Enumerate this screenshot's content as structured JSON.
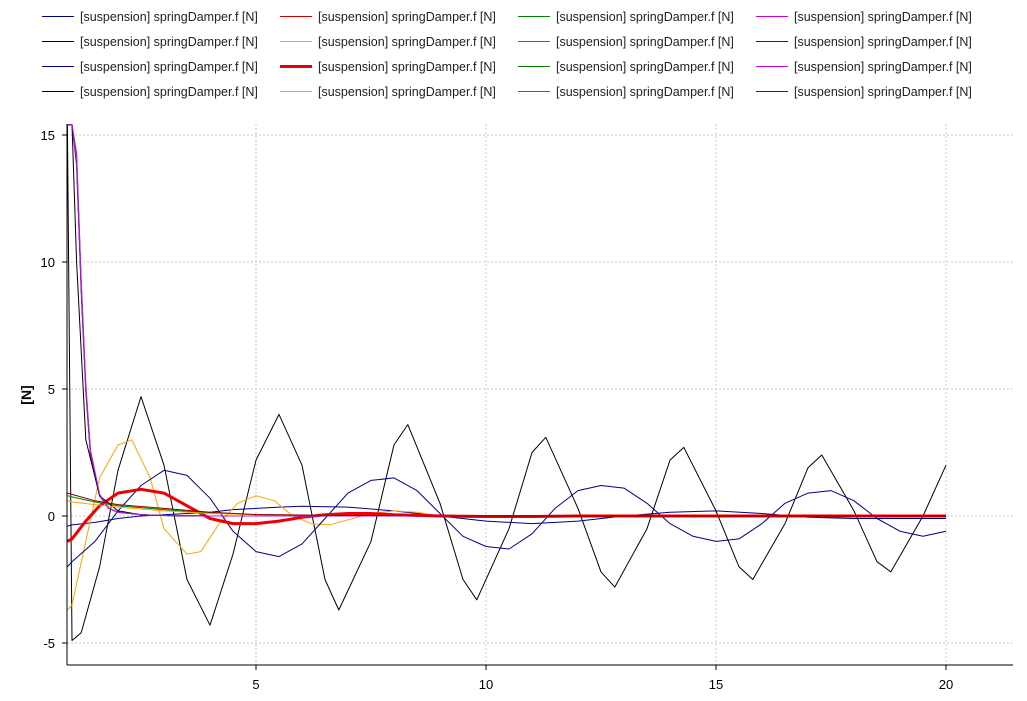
{
  "chart_data": {
    "type": "line",
    "xlabel": "",
    "ylabel": "[N]",
    "xlim": [
      0.5,
      21.5
    ],
    "ylim": [
      -5.8,
      15.4
    ],
    "xticks": [
      5,
      10,
      15,
      20
    ],
    "yticks": [
      -5,
      0,
      5,
      10,
      15
    ],
    "grid": true,
    "legend_position": "top",
    "legend_columns": 4,
    "series": [
      {
        "label": "[suspension] springDamper.f [N]",
        "color": "#00008b",
        "width": 1,
        "x": [
          0.9,
          1.0,
          1.5,
          2.0,
          2.5,
          3.0,
          3.5,
          4.0,
          4.5,
          5.0,
          5.5,
          6.0,
          7.0,
          8.0,
          9.0,
          10.0,
          11.0,
          12.0,
          13.0,
          14.0,
          15.0,
          16.0,
          17.0,
          18.0,
          19.0,
          20.0
        ],
        "y": [
          -0.4,
          -0.35,
          -0.25,
          -0.1,
          0.0,
          0.05,
          0.1,
          0.15,
          0.25,
          0.3,
          0.35,
          0.38,
          0.35,
          0.2,
          0.0,
          -0.2,
          -0.3,
          -0.2,
          0.0,
          0.15,
          0.2,
          0.1,
          -0.05,
          -0.1,
          -0.1,
          -0.1
        ]
      },
      {
        "label": "[suspension] springDamper.f [N]",
        "color": "#cd0000",
        "width": 1,
        "x": [
          0.9,
          1.0,
          1.1,
          1.2,
          1.3,
          1.4,
          1.6,
          1.8,
          2.0,
          2.5,
          3.0,
          4.0,
          5.0,
          10.0,
          20.0
        ],
        "y": [
          15.4,
          15.4,
          14.0,
          9.0,
          5.0,
          2.5,
          0.8,
          0.3,
          0.15,
          0.05,
          0.02,
          0.0,
          0.0,
          0.0,
          0.0
        ]
      },
      {
        "label": "[suspension] springDamper.f [N]",
        "color": "#008000",
        "width": 1,
        "x": [
          0.9,
          1.0,
          1.1,
          1.2,
          1.3,
          1.4,
          1.6,
          1.8,
          2.0,
          2.5,
          3.0,
          4.0,
          5.0,
          10.0,
          20.0
        ],
        "y": [
          15.4,
          15.4,
          13.8,
          8.8,
          4.9,
          2.4,
          0.8,
          0.3,
          0.15,
          0.05,
          0.02,
          0.0,
          0.0,
          0.0,
          0.0
        ]
      },
      {
        "label": "[suspension] springDamper.f [N]",
        "color": "#cd00cd",
        "width": 1,
        "x": [
          0.9,
          1.0,
          1.1,
          1.2,
          1.3,
          1.4,
          1.6,
          1.8,
          2.0,
          2.5,
          3.0,
          4.0,
          5.0,
          10.0,
          20.0
        ],
        "y": [
          15.4,
          15.4,
          14.2,
          9.2,
          5.1,
          2.6,
          0.85,
          0.3,
          0.15,
          0.05,
          0.02,
          0.0,
          0.0,
          0.0,
          0.0
        ]
      },
      {
        "label": "[suspension] springDamper.f [N]",
        "color": "#000000",
        "width": 1,
        "x": [
          0.9,
          1.0,
          1.2,
          1.6,
          2.0,
          2.5,
          3.0,
          3.5,
          4.0,
          4.5,
          5.0,
          5.5,
          6.0,
          6.5,
          6.8,
          7.5,
          8.0,
          8.3,
          9.0,
          9.5,
          9.8,
          10.5,
          11.0,
          11.3,
          12.0,
          12.5,
          12.8,
          13.5,
          14.0,
          14.3,
          15.0,
          15.5,
          15.8,
          16.5,
          17.0,
          17.3,
          18.0,
          18.5,
          18.8,
          19.5,
          20.0
        ],
        "y": [
          15.4,
          -4.9,
          -4.6,
          -2.0,
          1.8,
          4.7,
          2.0,
          -2.5,
          -4.3,
          -1.5,
          2.2,
          4.0,
          2.0,
          -2.5,
          -3.7,
          -1.0,
          2.8,
          3.6,
          0.5,
          -2.5,
          -3.3,
          -0.5,
          2.5,
          3.1,
          0.3,
          -2.2,
          -2.8,
          -0.5,
          2.2,
          2.7,
          0.2,
          -2.0,
          -2.5,
          -0.3,
          1.9,
          2.4,
          0.2,
          -1.8,
          -2.2,
          0.0,
          2.0
        ]
      },
      {
        "label": "[suspension] springDamper.f [N]",
        "color": "#ffa500",
        "width": 1,
        "x": [
          0.9,
          1.0,
          1.3,
          1.6,
          2.0,
          2.3,
          2.7,
          3.0,
          3.5,
          3.8,
          4.2,
          4.6,
          5.0,
          5.4,
          5.8,
          6.2,
          6.6,
          7.0,
          7.5,
          8.0,
          8.5,
          9.0,
          9.5,
          10.0,
          11.0,
          12.0,
          20.0
        ],
        "y": [
          -3.7,
          -3.5,
          -1.0,
          1.5,
          2.8,
          3.0,
          1.5,
          -0.5,
          -1.5,
          -1.4,
          -0.3,
          0.5,
          0.8,
          0.6,
          0.0,
          -0.3,
          -0.35,
          -0.15,
          0.1,
          0.2,
          0.15,
          0.0,
          -0.05,
          -0.05,
          0.0,
          0.0,
          0.0
        ]
      },
      {
        "label": "[suspension] springDamper.f [N]",
        "color": "#a020f0",
        "width": 1,
        "x": [
          0.9,
          1.0,
          1.1,
          1.2,
          1.3,
          1.4,
          1.6,
          1.8,
          2.0,
          2.5,
          3.0,
          4.0,
          5.0,
          10.0,
          20.0
        ],
        "y": [
          15.4,
          15.4,
          14.1,
          9.1,
          5.0,
          2.5,
          0.8,
          0.3,
          0.15,
          0.05,
          0.02,
          0.0,
          0.0,
          0.0,
          0.0
        ]
      },
      {
        "label": "[suspension] springDamper.f [N]",
        "color": "#8b0000",
        "width": 1,
        "x": [
          0.9,
          1.0,
          1.1,
          1.2,
          1.3,
          1.4,
          1.6,
          1.8,
          2.0,
          2.5,
          3.0,
          4.0,
          5.0,
          10.0,
          20.0
        ],
        "y": [
          15.4,
          15.4,
          13.9,
          8.9,
          4.95,
          2.45,
          0.8,
          0.3,
          0.15,
          0.05,
          0.02,
          0.0,
          0.0,
          0.0,
          0.0
        ]
      },
      {
        "label": "[suspension] springDamper.f [N]",
        "color": "#00008b",
        "width": 1,
        "x": [
          0.9,
          1.0,
          1.5,
          2.0,
          2.5,
          3.0,
          3.5,
          4.0,
          4.5,
          5.0,
          5.5,
          6.0,
          6.5,
          7.0,
          7.5,
          8.0,
          8.5,
          9.0,
          9.5,
          10.0,
          10.5,
          11.0,
          11.5,
          12.0,
          12.5,
          13.0,
          13.5,
          14.0,
          14.5,
          15.0,
          15.5,
          16.0,
          16.5,
          17.0,
          17.5,
          18.0,
          18.5,
          19.0,
          19.5,
          20.0
        ],
        "y": [
          -2.0,
          -1.8,
          -1.0,
          0.2,
          1.2,
          1.8,
          1.6,
          0.7,
          -0.6,
          -1.4,
          -1.6,
          -1.1,
          -0.1,
          0.9,
          1.4,
          1.5,
          1.0,
          0.1,
          -0.8,
          -1.2,
          -1.3,
          -0.7,
          0.3,
          1.0,
          1.2,
          1.1,
          0.5,
          -0.3,
          -0.8,
          -1.0,
          -0.9,
          -0.3,
          0.5,
          0.9,
          1.0,
          0.6,
          -0.1,
          -0.6,
          -0.8,
          -0.6
        ]
      },
      {
        "label": "[suspension] springDamper.f [N]",
        "color": "#ee0000",
        "width": 3,
        "x": [
          0.9,
          1.0,
          1.3,
          1.6,
          2.0,
          2.5,
          3.0,
          3.5,
          4.0,
          4.5,
          5.0,
          5.5,
          6.0,
          6.5,
          7.0,
          7.5,
          8.0,
          9.0,
          10.0,
          11.0,
          12.0,
          14.0,
          17.0,
          20.0
        ],
        "y": [
          -1.0,
          -0.9,
          -0.2,
          0.4,
          0.9,
          1.05,
          0.9,
          0.4,
          -0.1,
          -0.3,
          -0.3,
          -0.2,
          -0.05,
          0.05,
          0.1,
          0.1,
          0.05,
          0.0,
          -0.02,
          -0.02,
          0.0,
          0.0,
          0.0,
          0.0
        ]
      },
      {
        "label": "[suspension] springDamper.f [N]",
        "color": "#008000",
        "width": 1,
        "x": [
          0.9,
          1.0,
          1.5,
          2.0,
          3.0,
          4.0,
          5.0,
          7.0,
          10.0,
          20.0
        ],
        "y": [
          0.8,
          0.75,
          0.55,
          0.4,
          0.25,
          0.12,
          0.05,
          0.02,
          0.0,
          0.0
        ]
      },
      {
        "label": "[suspension] springDamper.f [N]",
        "color": "#cd00cd",
        "width": 1,
        "x": [
          0.9,
          1.0,
          1.1,
          1.2,
          1.3,
          1.4,
          1.6,
          1.8,
          2.0,
          2.5,
          3.0,
          4.0,
          5.0,
          10.0,
          20.0
        ],
        "y": [
          15.4,
          15.4,
          14.0,
          9.0,
          5.0,
          2.5,
          0.8,
          0.3,
          0.15,
          0.05,
          0.02,
          0.0,
          0.0,
          0.0,
          0.0
        ]
      },
      {
        "label": "[suspension] springDamper.f [N]",
        "color": "#000000",
        "width": 1,
        "x": [
          0.9,
          1.0,
          1.1,
          1.3,
          1.6,
          2.0,
          2.5,
          3.0,
          4.0,
          5.0,
          10.0,
          20.0
        ],
        "y": [
          15.4,
          15.4,
          10.0,
          3.0,
          0.8,
          0.2,
          0.05,
          0.02,
          0.0,
          0.0,
          0.0,
          0.0
        ]
      },
      {
        "label": "[suspension] springDamper.f [N]",
        "color": "#ffa500",
        "width": 1,
        "x": [
          0.9,
          1.0,
          1.5,
          2.0,
          3.0,
          4.0,
          5.0,
          7.0,
          10.0,
          20.0
        ],
        "y": [
          0.6,
          0.55,
          0.45,
          0.35,
          0.2,
          0.1,
          0.05,
          0.02,
          0.0,
          0.0
        ]
      },
      {
        "label": "[suspension] springDamper.f [N]",
        "color": "#a020f0",
        "width": 1,
        "x": [
          0.9,
          1.0,
          1.1,
          1.2,
          1.3,
          1.4,
          1.6,
          1.8,
          2.0,
          2.5,
          3.0,
          4.0,
          5.0,
          10.0,
          20.0
        ],
        "y": [
          15.4,
          15.4,
          14.3,
          9.3,
          5.2,
          2.6,
          0.85,
          0.3,
          0.15,
          0.05,
          0.02,
          0.0,
          0.0,
          0.0,
          0.0
        ]
      },
      {
        "label": "[suspension] springDamper.f [N]",
        "color": "#8b0000",
        "width": 1,
        "x": [
          0.9,
          1.0,
          1.5,
          2.0,
          3.0,
          4.0,
          5.0,
          7.0,
          10.0,
          20.0
        ],
        "y": [
          0.9,
          0.85,
          0.6,
          0.45,
          0.3,
          0.15,
          0.06,
          0.02,
          0.0,
          0.0
        ]
      }
    ]
  }
}
